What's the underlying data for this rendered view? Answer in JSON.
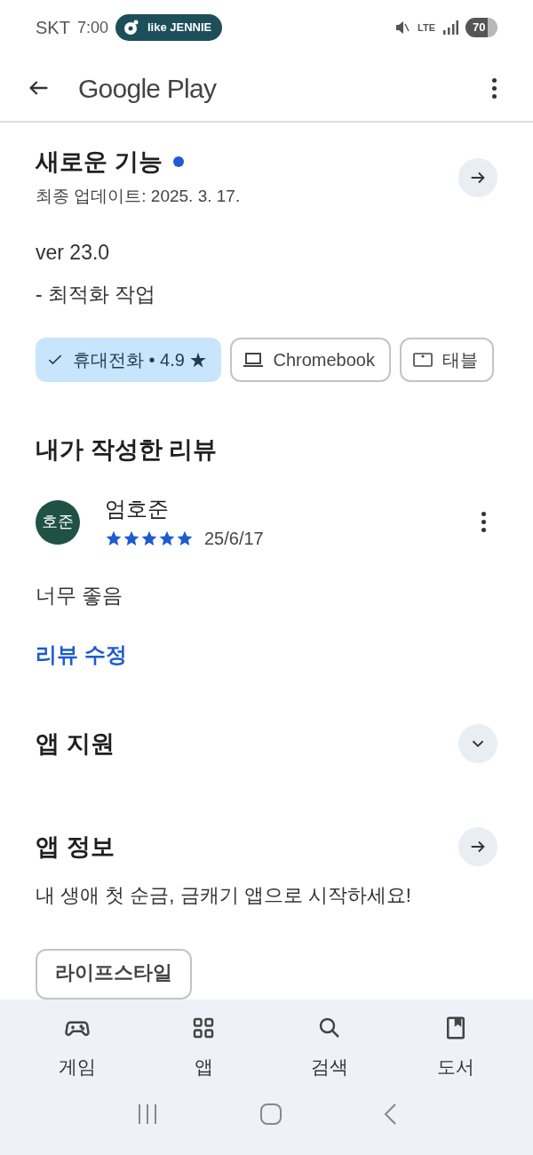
{
  "status_bar": {
    "carrier": "SKT",
    "time": "7:00",
    "now_playing": "like JENNIE",
    "network": "LTE",
    "battery": "70"
  },
  "header": {
    "title": "Google Play"
  },
  "whats_new": {
    "title": "새로운 기능",
    "new": true,
    "updated": "최종 업데이트: 2025. 3. 17.",
    "lines": [
      "ver 23.0",
      "- 최적화 작업"
    ]
  },
  "devices": [
    {
      "kind": "phone",
      "label": "휴대전화 • 4.9 ★",
      "selected": true
    },
    {
      "kind": "laptop",
      "label": "Chromebook",
      "selected": false
    },
    {
      "kind": "tablet",
      "label": "태블",
      "selected": false
    }
  ],
  "my_review": {
    "title": "내가 작성한 리뷰",
    "avatar": "호준",
    "author": "엄호준",
    "stars": 5,
    "date": "25/6/17",
    "text": "너무 좋음",
    "edit_link": "리뷰 수정"
  },
  "app_support": {
    "title": "앱 지원",
    "expanded": false
  },
  "app_info": {
    "title": "앱 정보",
    "description": "내 생애 첫 순금, 금캐기 앱으로 시작하세요!",
    "category": "라이프스타일"
  },
  "bottom_nav": [
    {
      "kind": "games",
      "label": "게임",
      "selected": false
    },
    {
      "kind": "apps",
      "label": "앱",
      "selected": false
    },
    {
      "kind": "search",
      "label": "검색",
      "selected": false
    },
    {
      "kind": "books",
      "label": "도서",
      "selected": false
    }
  ]
}
